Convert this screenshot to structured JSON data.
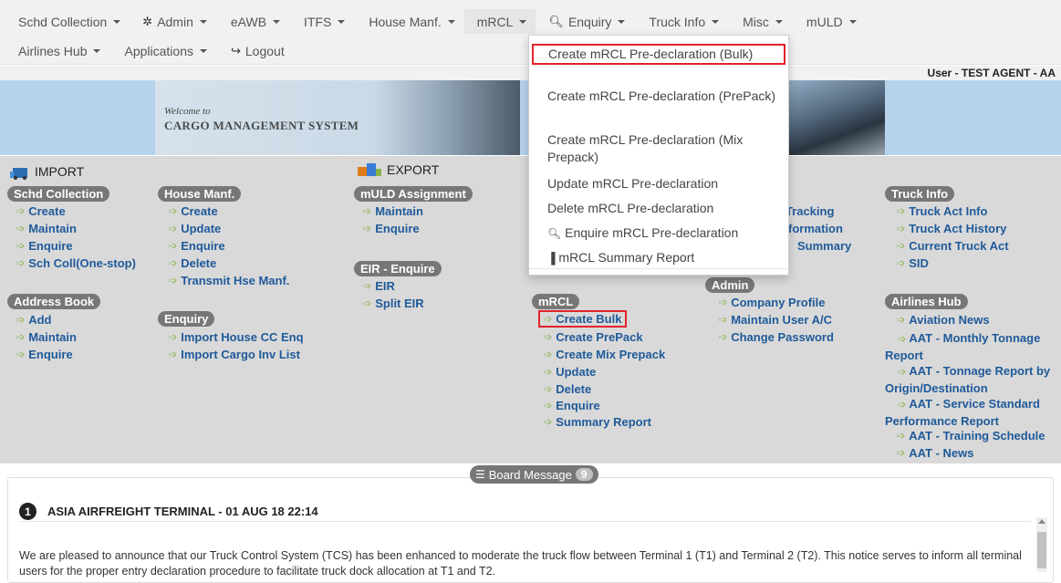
{
  "nav": {
    "row1": [
      {
        "label": "Schd Collection",
        "caret": true,
        "icon": ""
      },
      {
        "label": "Admin",
        "caret": true,
        "icon": "gear-icon"
      },
      {
        "label": "eAWB",
        "caret": true,
        "icon": ""
      },
      {
        "label": "ITFS",
        "caret": true,
        "icon": ""
      },
      {
        "label": "House Manf.",
        "caret": true,
        "icon": ""
      },
      {
        "label": "mRCL",
        "caret": true,
        "icon": ""
      },
      {
        "label": "Enquiry",
        "caret": true,
        "icon": "search-icon"
      },
      {
        "label": "Truck Info",
        "caret": true,
        "icon": ""
      },
      {
        "label": "Misc",
        "caret": true,
        "icon": ""
      },
      {
        "label": "mULD",
        "caret": true,
        "icon": ""
      }
    ],
    "row2": [
      {
        "label": "Airlines Hub",
        "caret": true,
        "icon": ""
      },
      {
        "label": "Applications",
        "caret": true,
        "icon": ""
      },
      {
        "label": "Logout",
        "caret": false,
        "icon": "logout-icon"
      }
    ]
  },
  "dropdown": {
    "items": [
      {
        "label": "Create mRCL Pre-declaration (Bulk)",
        "icon": "",
        "selected": true
      },
      {
        "label": "Create mRCL Pre-declaration (PrePack)",
        "icon": "",
        "selected": false
      },
      {
        "label": "Create mRCL Pre-declaration (Mix Prepack)",
        "icon": "",
        "selected": false
      },
      {
        "label": "Update mRCL Pre-declaration",
        "icon": "",
        "selected": false
      },
      {
        "label": "Delete mRCL Pre-declaration",
        "icon": "",
        "selected": false
      },
      {
        "label": "Enquire mRCL Pre-declaration",
        "icon": "search-icon",
        "selected": false
      },
      {
        "label": "mRCL Summary Report",
        "icon": "bar-chart-icon",
        "selected": false
      }
    ]
  },
  "user": {
    "text": "User - TEST AGENT - AA"
  },
  "banner": {
    "welcome": "Welcome to",
    "title": "CARGO MANAGEMENT SYSTEM"
  },
  "sections": {
    "import": "IMPORT",
    "export": "EXPORT"
  },
  "groups": {
    "schd_collection": {
      "title": "Schd Collection",
      "links": [
        "Create",
        "Maintain",
        "Enquire",
        "Sch Coll(One-stop)"
      ]
    },
    "house_manf": {
      "title": "House Manf.",
      "links": [
        "Create",
        "Update",
        "Enquire",
        "Delete",
        "Transmit Hse Manf."
      ]
    },
    "muld_assignment": {
      "title": "mULD Assignment",
      "links": [
        "Maintain",
        "Enquire"
      ]
    },
    "eir_enquire": {
      "title": "EIR - Enquire",
      "links": [
        "EIR",
        "Split EIR"
      ]
    },
    "address_book": {
      "title": "Address Book",
      "links": [
        "Add",
        "Maintain",
        "Enquire"
      ]
    },
    "enquiry": {
      "title": "Enquiry",
      "links": [
        "Import House CC Enq",
        "Import Cargo Inv List"
      ]
    },
    "mrcl": {
      "title": "mRCL",
      "links": [
        "Create Bulk",
        "Create PrePack",
        "Create Mix Prepack",
        "Update",
        "Delete",
        "Enquire",
        "Summary Report"
      ]
    },
    "truck_partial": {
      "links": [
        "t Tracking",
        "formation",
        "Summary"
      ]
    },
    "admin": {
      "title": "Admin",
      "links": [
        "Company Profile",
        "Maintain User A/C",
        "Change Password"
      ]
    },
    "truck_info": {
      "title": "Truck Info",
      "links": [
        "Truck Act Info",
        "Truck Act History",
        "Current Truck Act",
        "SID"
      ]
    },
    "airlines_hub": {
      "title": "Airlines Hub",
      "links": [
        "Aviation News",
        "AAT - Monthly Tonnage Report",
        "AAT - Tonnage Report by Origin/Destination",
        "AAT - Service Standard Performance Report",
        "AAT - Training Schedule",
        "AAT - News"
      ]
    }
  },
  "board": {
    "title": "Board Message",
    "count": "9",
    "message": {
      "number": "1",
      "heading": "ASIA AIRFREIGHT TERMINAL - 01 AUG 18 22:14",
      "body": "We are pleased to announce that our Truck Control System (TCS) has been enhanced to moderate the truck flow between Terminal 1 (T1) and Terminal 2 (T2). This notice serves to inform all terminal users for the proper entry declaration procedure to facilitate truck dock allocation at T1 and T2."
    }
  },
  "colors": {
    "link": "#1f5a9a",
    "arrow": "#8ab34a",
    "highlight": "#e3222b",
    "pill": "#777777"
  }
}
